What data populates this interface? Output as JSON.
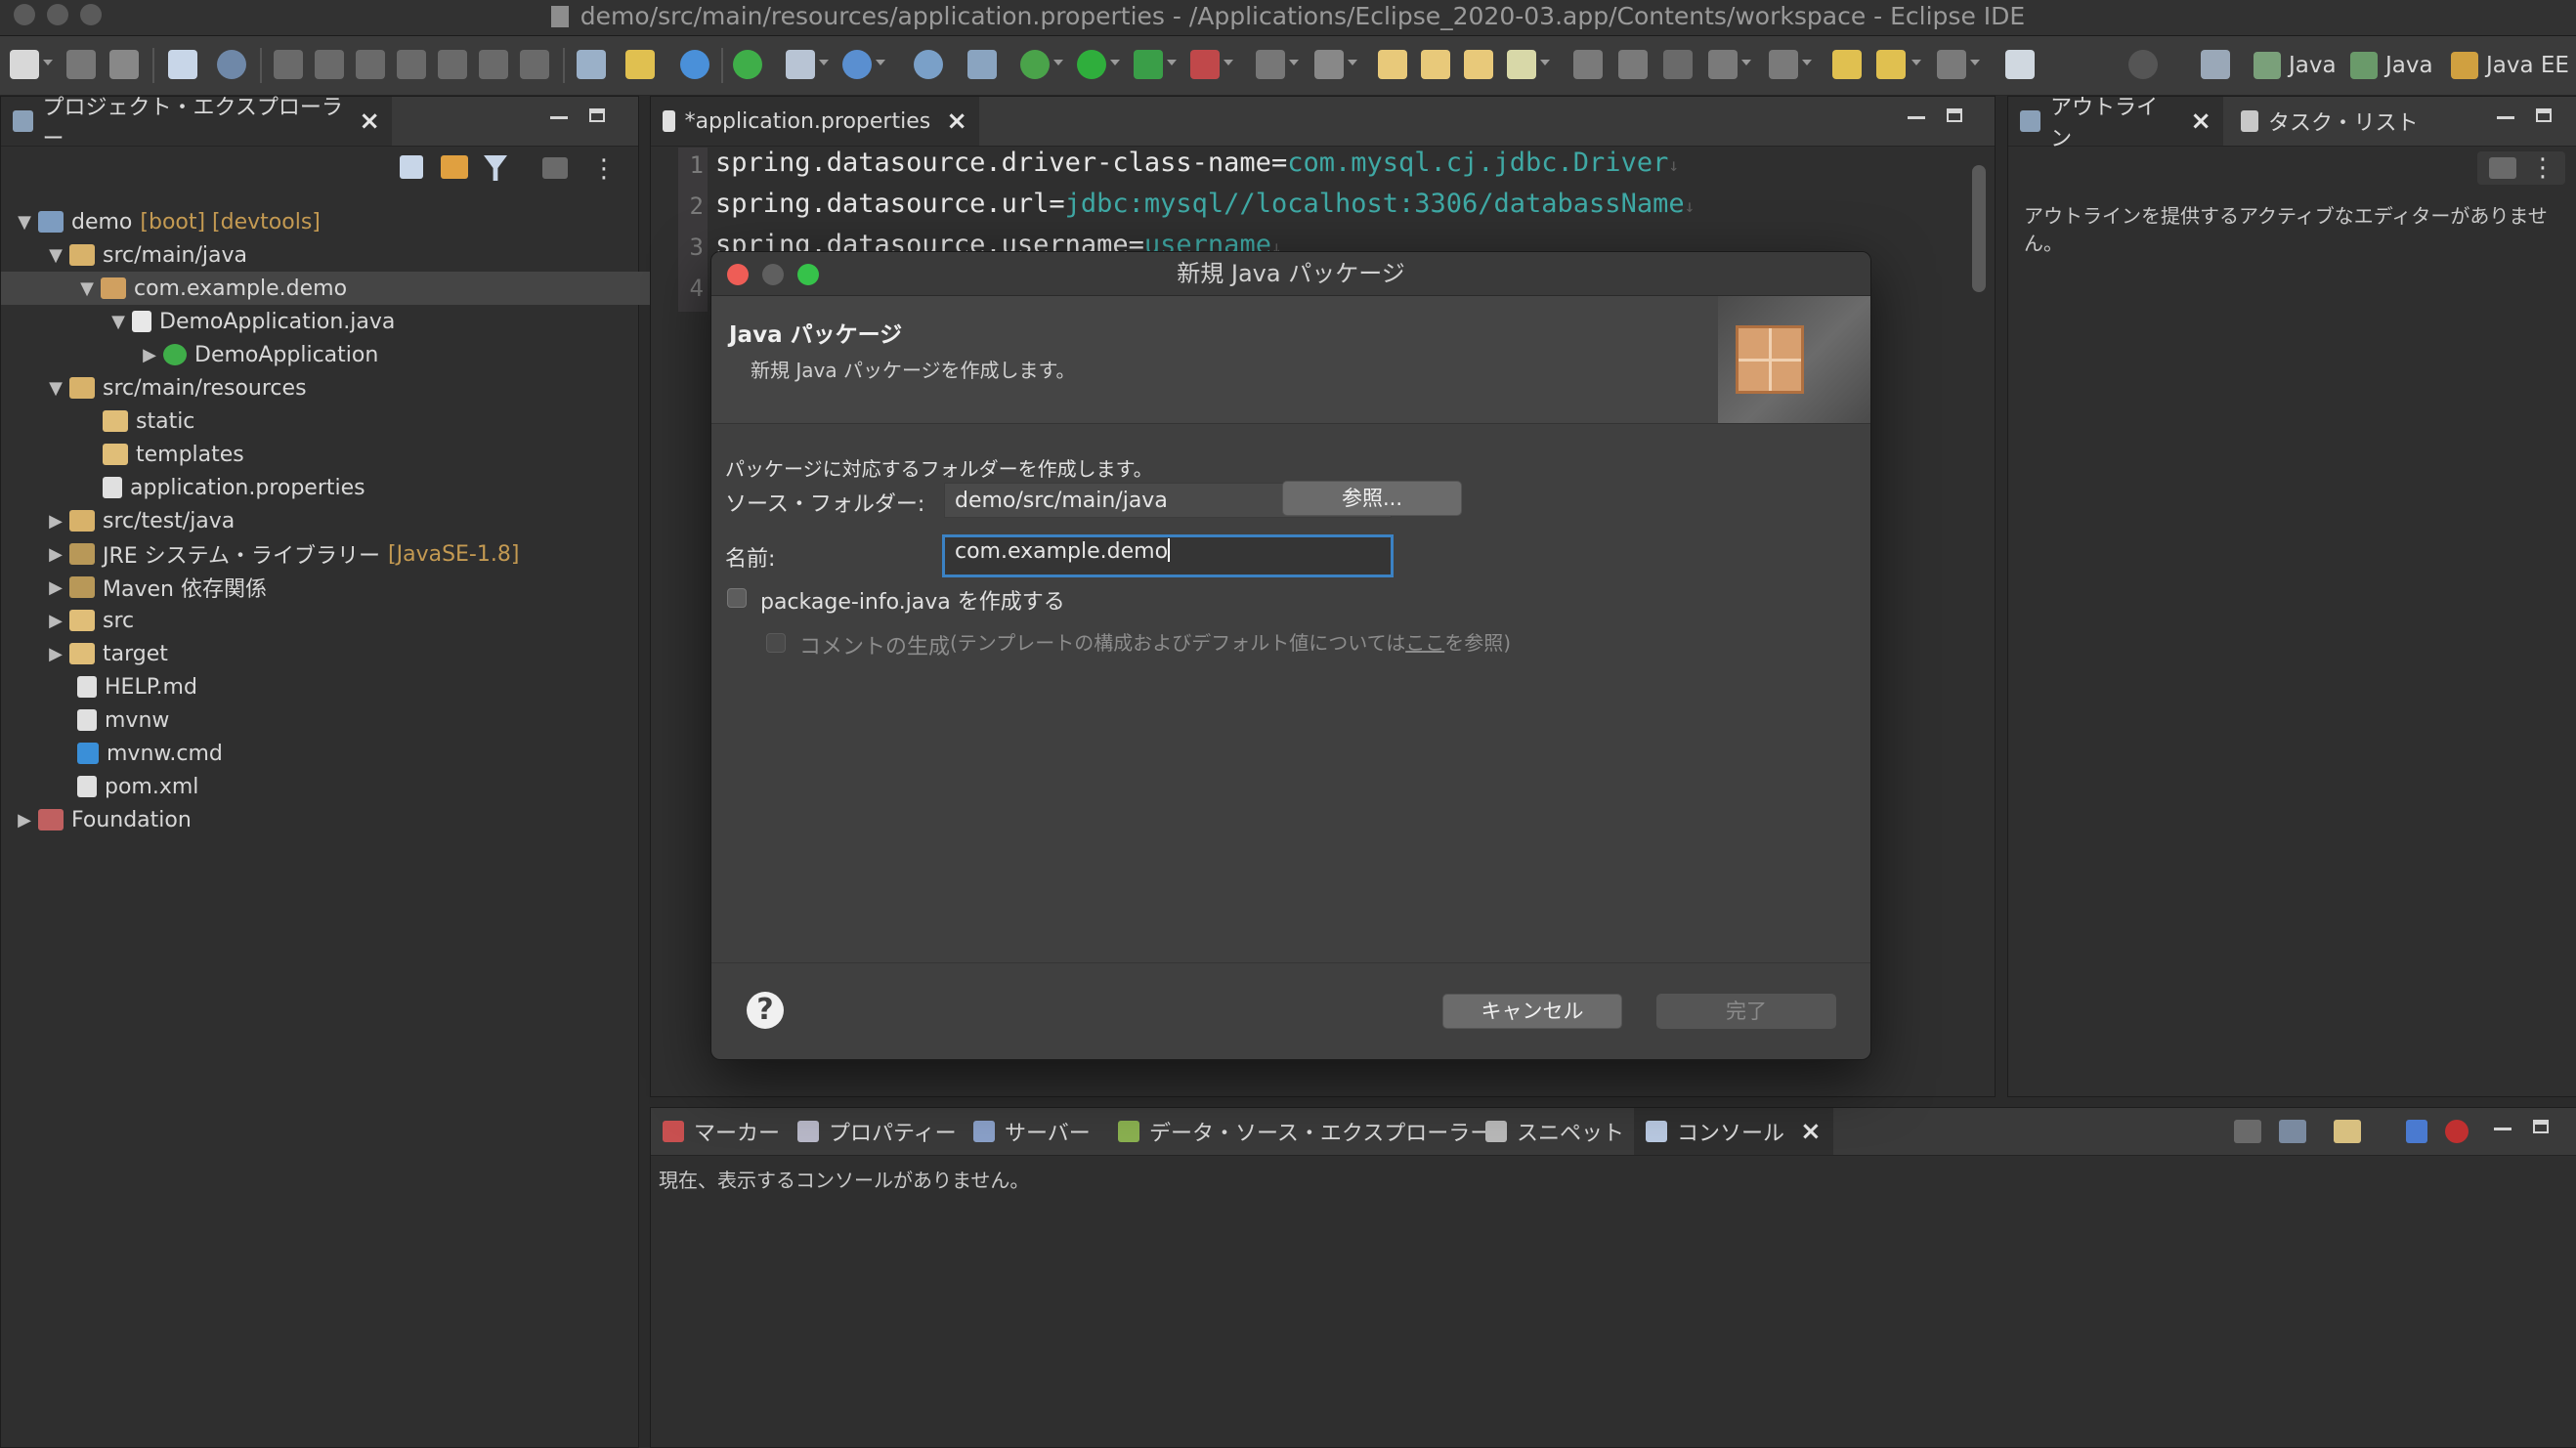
{
  "window": {
    "title": "demo/src/main/resources/application.properties - /Applications/Eclipse_2020-03.app/Contents/workspace - Eclipse IDE"
  },
  "perspectives": [
    "Java",
    "Java",
    "Java EE"
  ],
  "explorer": {
    "title": "プロジェクト・エクスプローラー",
    "items": [
      {
        "label": "demo",
        "deco": "[boot] [devtools]"
      },
      {
        "label": "src/main/java"
      },
      {
        "label": "com.example.demo"
      },
      {
        "label": "DemoApplication.java"
      },
      {
        "label": "DemoApplication"
      },
      {
        "label": "src/main/resources"
      },
      {
        "label": "static"
      },
      {
        "label": "templates"
      },
      {
        "label": "application.properties"
      },
      {
        "label": "src/test/java"
      },
      {
        "label": "JRE システム・ライブラリー",
        "deco": "[JavaSE-1.8]"
      },
      {
        "label": "Maven 依存関係"
      },
      {
        "label": "src"
      },
      {
        "label": "target"
      },
      {
        "label": "HELP.md"
      },
      {
        "label": "mvnw"
      },
      {
        "label": "mvnw.cmd"
      },
      {
        "label": "pom.xml"
      },
      {
        "label": "Foundation"
      }
    ]
  },
  "editor": {
    "tab": "*application.properties",
    "lines": [
      {
        "num": "1",
        "key": "spring.datasource.driver-class-name=",
        "value": "com.mysql.cj.jdbc.Driver"
      },
      {
        "num": "2",
        "key": "spring.datasource.url=",
        "value": "jdbc:mysql//localhost:3306/databassName"
      },
      {
        "num": "3",
        "key": "spring.datasource.username=",
        "value": "username"
      },
      {
        "num": "4",
        "key": "",
        "value": ""
      }
    ]
  },
  "outline": {
    "tab": "アウトライン",
    "tab2": "タスク・リスト",
    "message": "アウトラインを提供するアクティブなエディターがありません。"
  },
  "bottom": {
    "tabs": [
      "マーカー",
      "プロパティー",
      "サーバー",
      "データ・ソース・エクスプローラー",
      "スニペット",
      "コンソール"
    ],
    "message": "現在、表示するコンソールがありません。"
  },
  "dialog": {
    "title": "新規 Java パッケージ",
    "header_title": "Java パッケージ",
    "header_desc": "新規 Java パッケージを作成します。",
    "info": "パッケージに対応するフォルダーを作成します。",
    "source_label": "ソース・フォルダー:",
    "source_value": "demo/src/main/java",
    "browse": "参照...",
    "name_label": "名前:",
    "name_value": "com.example.demo",
    "pkginfo_label": "package-info.java を作成する",
    "comment_label": "コメントの生成",
    "comment_hint_pre": "(テンプレートの構成およびデフォルト値については",
    "comment_hint_link": "ここ",
    "comment_hint_post": "を参照)",
    "cancel": "キャンセル",
    "finish": "完了"
  }
}
